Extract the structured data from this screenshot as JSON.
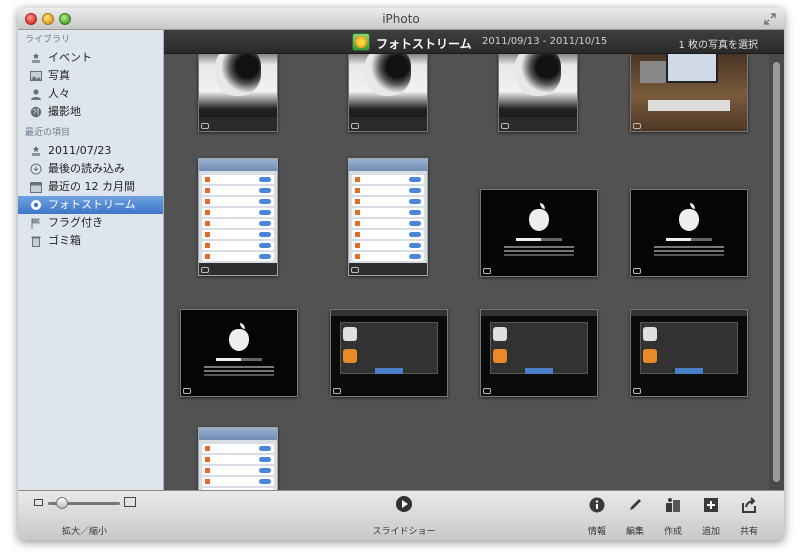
{
  "window": {
    "title": "iPhoto"
  },
  "sidebar": {
    "sections": [
      {
        "header": "ライブラリ",
        "items": [
          {
            "label": "イベント",
            "icon": "events-icon"
          },
          {
            "label": "写真",
            "icon": "photos-icon"
          },
          {
            "label": "人々",
            "icon": "faces-icon"
          },
          {
            "label": "撮影地",
            "icon": "places-icon"
          }
        ]
      },
      {
        "header": "最近の項目",
        "items": [
          {
            "label": "2011/07/23",
            "icon": "event-icon"
          },
          {
            "label": "最後の読み込み",
            "icon": "last-import-icon"
          },
          {
            "label": "最近の 12 カ月間",
            "icon": "calendar-icon"
          },
          {
            "label": "フォトストリーム",
            "icon": "photostream-icon",
            "selected": true
          },
          {
            "label": "フラグ付き",
            "icon": "flag-icon"
          },
          {
            "label": "ゴミ箱",
            "icon": "trash-icon"
          }
        ]
      }
    ]
  },
  "main": {
    "title": "フォトストリーム",
    "date_range": "2011/09/13 - 2011/10/15",
    "selection": "1 枚の写真を選択"
  },
  "photos": [
    {
      "kind": "cat"
    },
    {
      "kind": "cat"
    },
    {
      "kind": "cat"
    },
    {
      "kind": "desk"
    },
    {
      "kind": "phone"
    },
    {
      "kind": "phone"
    },
    {
      "kind": "apple"
    },
    {
      "kind": "apple"
    },
    {
      "kind": "apple"
    },
    {
      "kind": "alert"
    },
    {
      "kind": "alert"
    },
    {
      "kind": "alert"
    },
    {
      "kind": "phone"
    }
  ],
  "bottom": {
    "zoom_label": "拡大／縮小",
    "zoom_level": 0.2,
    "slideshow_label": "スライドショー",
    "tools": [
      {
        "label": "情報",
        "icon": "info-icon"
      },
      {
        "label": "編集",
        "icon": "edit-icon"
      },
      {
        "label": "作成",
        "icon": "create-icon"
      },
      {
        "label": "追加",
        "icon": "add-icon"
      },
      {
        "label": "共有",
        "icon": "share-icon"
      }
    ]
  },
  "colors": {
    "selection": "#3d76c8",
    "viewer_background": "#525252",
    "sidebar_background": "#dfe5ed"
  }
}
